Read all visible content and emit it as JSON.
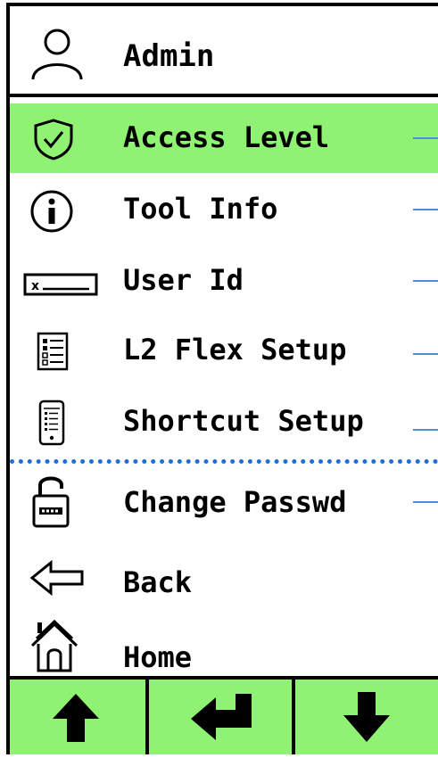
{
  "header": {
    "title": "Admin",
    "icon": "user-icon"
  },
  "menu": [
    {
      "label": "Access Level",
      "icon": "shield-check-icon",
      "selected": true
    },
    {
      "label": "Tool Info",
      "icon": "info-icon",
      "selected": false
    },
    {
      "label": "User Id",
      "icon": "id-field-icon",
      "selected": false
    },
    {
      "label": "L2 Flex Setup",
      "icon": "checklist-icon",
      "selected": false
    },
    {
      "label": "Shortcut Setup",
      "icon": "phone-list-icon",
      "selected": false
    },
    {
      "label": "Change Passwd",
      "icon": "unlocked-padlock-icon",
      "selected": false
    },
    {
      "label": "Back",
      "icon": "arrow-left-icon",
      "selected": false
    },
    {
      "label": "Home",
      "icon": "home-icon",
      "selected": false
    }
  ],
  "footer": {
    "buttons": [
      {
        "icon": "arrow-up-icon"
      },
      {
        "icon": "enter-icon"
      },
      {
        "icon": "arrow-down-icon"
      }
    ]
  },
  "colors": {
    "highlight": "#8ff272",
    "connector": "#4a90d9",
    "divider": "#1e6fd6"
  }
}
